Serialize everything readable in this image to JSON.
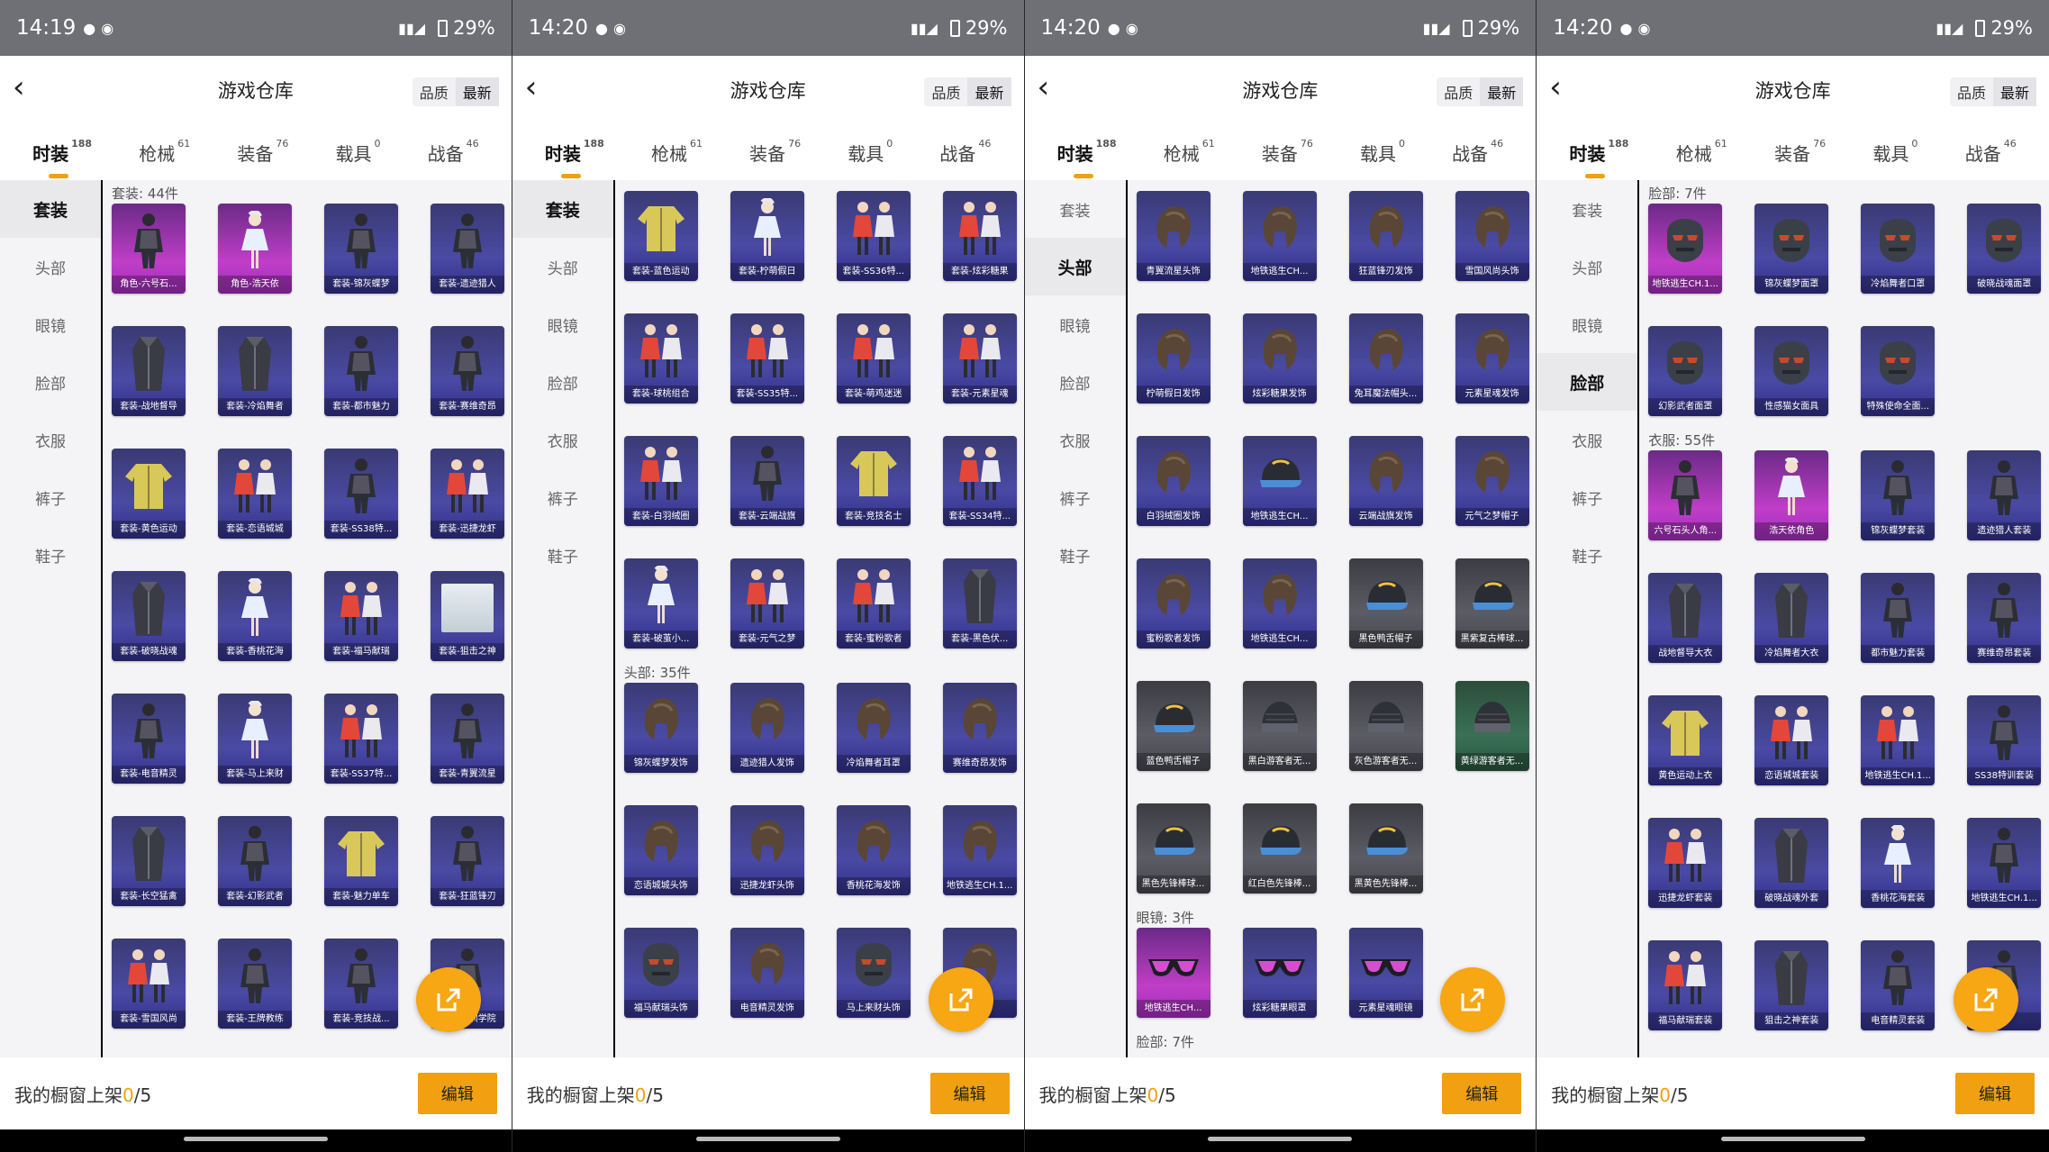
{
  "screens": [
    {
      "status": {
        "time": "14:19",
        "battery": "29%"
      },
      "header": {
        "title": "游戏仓库",
        "sort": [
          "品质",
          "最新"
        ]
      },
      "tabs": [
        {
          "label": "时装",
          "count": "188",
          "active": true
        },
        {
          "label": "枪械",
          "count": "61"
        },
        {
          "label": "装备",
          "count": "76"
        },
        {
          "label": "载具",
          "count": "0"
        },
        {
          "label": "战备",
          "count": "46"
        }
      ],
      "sidebar": [
        {
          "label": "套装",
          "active": true
        },
        {
          "label": "头部"
        },
        {
          "label": "眼镜"
        },
        {
          "label": "脸部"
        },
        {
          "label": "衣服"
        },
        {
          "label": "裤子"
        },
        {
          "label": "鞋子"
        }
      ],
      "sections": [
        {
          "title": "套装: 44件",
          "items": [
            {
              "name": "角色-六号石...",
              "icon": "outfit",
              "r": 0
            },
            {
              "name": "角色-浩天依",
              "icon": "girl",
              "r": 0
            },
            {
              "name": "套装-锦灰蝶梦",
              "icon": "outfit",
              "r": 1
            },
            {
              "name": "套装-遗迹猎人",
              "icon": "outfit",
              "r": 1
            },
            {
              "name": "套装-战地督导",
              "icon": "coat",
              "r": 1
            },
            {
              "name": "套装-冷焰舞者",
              "icon": "coat",
              "r": 1
            },
            {
              "name": "套装-都市魅力",
              "icon": "outfit",
              "r": 1
            },
            {
              "name": "套装-赛维奇昂",
              "icon": "outfit",
              "r": 1
            },
            {
              "name": "套装-黄色运动",
              "icon": "jacket",
              "r": 1
            },
            {
              "name": "套装-恋语城城",
              "icon": "pair",
              "r": 1
            },
            {
              "name": "套装-SS38特...",
              "icon": "outfit",
              "r": 1
            },
            {
              "name": "套装-迅捷龙虾",
              "icon": "pair",
              "r": 1
            },
            {
              "name": "套装-破晓战魂",
              "icon": "coat",
              "r": 1
            },
            {
              "name": "套装-香桃花海",
              "icon": "girl",
              "r": 1
            },
            {
              "name": "套装-福马献瑞",
              "icon": "pair",
              "r": 1
            },
            {
              "name": "套装-狙击之神",
              "icon": "photo",
              "r": 1
            },
            {
              "name": "套装-电音精灵",
              "icon": "outfit",
              "r": 1
            },
            {
              "name": "套装-马上来财",
              "icon": "girl",
              "r": 1
            },
            {
              "name": "套装-SS37特...",
              "icon": "pair",
              "r": 1
            },
            {
              "name": "套装-青翼流星",
              "icon": "outfit",
              "r": 1
            },
            {
              "name": "套装-长空猛禽",
              "icon": "coat",
              "r": 1
            },
            {
              "name": "套装-幻影武者",
              "icon": "outfit",
              "r": 1
            },
            {
              "name": "套装-魅力单车",
              "icon": "jacket",
              "r": 1
            },
            {
              "name": "套装-狂蓝锋刃",
              "icon": "outfit",
              "r": 1
            },
            {
              "name": "套装-雪国风尚",
              "icon": "pair",
              "r": 1
            },
            {
              "name": "套装-王牌教练",
              "icon": "outfit",
              "r": 1
            },
            {
              "name": "套装-竞技战...",
              "icon": "outfit",
              "r": 1
            },
            {
              "name": "套装-特训学院",
              "icon": "outfit",
              "r": 1
            }
          ]
        }
      ],
      "bottom": {
        "label": "我的橱窗上架",
        "count": "0",
        "total": "/5",
        "edit": "编辑"
      }
    },
    {
      "status": {
        "time": "14:20",
        "battery": "29%"
      },
      "header": {
        "title": "游戏仓库",
        "sort": [
          "品质",
          "最新"
        ]
      },
      "tabs": [
        {
          "label": "时装",
          "count": "188",
          "active": true
        },
        {
          "label": "枪械",
          "count": "61"
        },
        {
          "label": "装备",
          "count": "76"
        },
        {
          "label": "载具",
          "count": "0"
        },
        {
          "label": "战备",
          "count": "46"
        }
      ],
      "sidebar": [
        {
          "label": "套装",
          "active": true
        },
        {
          "label": "头部"
        },
        {
          "label": "眼镜"
        },
        {
          "label": "脸部"
        },
        {
          "label": "衣服"
        },
        {
          "label": "裤子"
        },
        {
          "label": "鞋子"
        }
      ],
      "sections": [
        {
          "title": "",
          "items": [
            {
              "name": "套装-蓝色运动",
              "icon": "jacket",
              "r": 1
            },
            {
              "name": "套装-柠萌假日",
              "icon": "girl",
              "r": 1
            },
            {
              "name": "套装-SS36特...",
              "icon": "pair",
              "r": 1
            },
            {
              "name": "套装-炫彩糖果",
              "icon": "pair",
              "r": 1
            },
            {
              "name": "套装-球桃组合",
              "icon": "pair",
              "r": 1
            },
            {
              "name": "套装-SS35特...",
              "icon": "pair",
              "r": 1
            },
            {
              "name": "套装-萌鸡迷迷",
              "icon": "pair",
              "r": 1
            },
            {
              "name": "套装-元素星魂",
              "icon": "pair",
              "r": 1
            },
            {
              "name": "套装-白羽绒圈",
              "icon": "pair",
              "r": 1
            },
            {
              "name": "套装-云端战旗",
              "icon": "outfit",
              "r": 1
            },
            {
              "name": "套装-竞技名士",
              "icon": "jacket",
              "r": 1
            },
            {
              "name": "套装-SS34特...",
              "icon": "pair",
              "r": 1
            },
            {
              "name": "套装-破茧小...",
              "icon": "girl",
              "r": 1
            },
            {
              "name": "套装-元气之梦",
              "icon": "pair",
              "r": 1
            },
            {
              "name": "套装-蜜粉歌者",
              "icon": "pair",
              "r": 1
            },
            {
              "name": "套装-黑色伏...",
              "icon": "coat",
              "r": 1
            }
          ]
        },
        {
          "title": "头部: 35件",
          "items": [
            {
              "name": "锦灰蝶梦发饰",
              "icon": "hair",
              "r": 1
            },
            {
              "name": "遗迹猎人发饰",
              "icon": "hair",
              "r": 1
            },
            {
              "name": "冷焰舞者耳罩",
              "icon": "hair",
              "r": 1
            },
            {
              "name": "赛维奇昂发饰",
              "icon": "hair",
              "r": 1
            },
            {
              "name": "恋语城城头饰",
              "icon": "hair",
              "r": 1
            },
            {
              "name": "迅捷龙虾头饰",
              "icon": "hair",
              "r": 1
            },
            {
              "name": "香桃花海发饰",
              "icon": "hair",
              "r": 1
            },
            {
              "name": "地铁逃生CH.1...",
              "icon": "hair",
              "r": 1
            },
            {
              "name": "福马献瑞头饰",
              "icon": "mask",
              "r": 1
            },
            {
              "name": "电音精灵发饰",
              "icon": "hair",
              "r": 1
            },
            {
              "name": "马上来财头饰",
              "icon": "mask",
              "r": 1
            },
            {
              "name": "...",
              "icon": "hair",
              "r": 1
            }
          ]
        }
      ],
      "bottom": {
        "label": "我的橱窗上架",
        "count": "0",
        "total": "/5",
        "edit": "编辑"
      }
    },
    {
      "status": {
        "time": "14:20",
        "battery": "29%"
      },
      "header": {
        "title": "游戏仓库",
        "sort": [
          "品质",
          "最新"
        ]
      },
      "tabs": [
        {
          "label": "时装",
          "count": "188",
          "active": true
        },
        {
          "label": "枪械",
          "count": "61"
        },
        {
          "label": "装备",
          "count": "76"
        },
        {
          "label": "载具",
          "count": "0"
        },
        {
          "label": "战备",
          "count": "46"
        }
      ],
      "sidebar": [
        {
          "label": "套装"
        },
        {
          "label": "头部",
          "active": true
        },
        {
          "label": "眼镜"
        },
        {
          "label": "脸部"
        },
        {
          "label": "衣服"
        },
        {
          "label": "裤子"
        },
        {
          "label": "鞋子"
        }
      ],
      "sections": [
        {
          "title": "",
          "items": [
            {
              "name": "青翼流星头饰",
              "icon": "hair",
              "r": 1
            },
            {
              "name": "地铁逃生CH...",
              "icon": "hair",
              "r": 1
            },
            {
              "name": "狂蓝锋刃发饰",
              "icon": "hair",
              "r": 1
            },
            {
              "name": "雪国风尚头饰",
              "icon": "hair",
              "r": 1
            },
            {
              "name": "柠萌假日发饰",
              "icon": "hair",
              "r": 1
            },
            {
              "name": "炫彩糖果发饰",
              "icon": "hair",
              "r": 1
            },
            {
              "name": "兔耳魔法帽头...",
              "icon": "hair",
              "r": 1
            },
            {
              "name": "元素星魂发饰",
              "icon": "hair",
              "r": 1
            },
            {
              "name": "白羽绒圈发饰",
              "icon": "hair",
              "r": 1
            },
            {
              "name": "地铁逃生CH...",
              "icon": "cap",
              "r": 1
            },
            {
              "name": "云端战旗发饰",
              "icon": "hair",
              "r": 1
            },
            {
              "name": "元气之梦帽子",
              "icon": "hair",
              "r": 1
            },
            {
              "name": "蜜粉歌者发饰",
              "icon": "hair",
              "r": 1
            },
            {
              "name": "地铁逃生CH...",
              "icon": "hair",
              "r": 1
            },
            {
              "name": "黑色鸭舌帽子",
              "icon": "cap",
              "r": 2
            },
            {
              "name": "黑紫复古棒球...",
              "icon": "cap",
              "r": 2
            },
            {
              "name": "蓝色鸭舌帽子",
              "icon": "cap",
              "r": 2
            },
            {
              "name": "黑白游客者无...",
              "icon": "beanie",
              "r": 2
            },
            {
              "name": "灰色游客者无...",
              "icon": "beanie",
              "r": 2
            },
            {
              "name": "黄绿游客者无...",
              "icon": "beanie",
              "r": 3
            },
            {
              "name": "黑色先锋棒球...",
              "icon": "cap",
              "r": 2
            },
            {
              "name": "红白色先锋棒...",
              "icon": "cap",
              "r": 2
            },
            {
              "name": "黑黄色先锋棒...",
              "icon": "cap",
              "r": 2
            }
          ]
        },
        {
          "title": "眼镜: 3件",
          "items": [
            {
              "name": "地铁逃生CH...",
              "icon": "glasses",
              "r": 0
            },
            {
              "name": "炫彩糖果眼罩",
              "icon": "glasses",
              "r": 1
            },
            {
              "name": "元素星魂眼镜",
              "icon": "glasses",
              "r": 1
            }
          ]
        },
        {
          "title": "脸部: 7件",
          "items": []
        }
      ],
      "bottom": {
        "label": "我的橱窗上架",
        "count": "0",
        "total": "/5",
        "edit": "编辑"
      }
    },
    {
      "status": {
        "time": "14:20",
        "battery": "29%"
      },
      "header": {
        "title": "游戏仓库",
        "sort": [
          "品质",
          "最新"
        ]
      },
      "tabs": [
        {
          "label": "时装",
          "count": "188",
          "active": true
        },
        {
          "label": "枪械",
          "count": "61"
        },
        {
          "label": "装备",
          "count": "76"
        },
        {
          "label": "载具",
          "count": "0"
        },
        {
          "label": "战备",
          "count": "46"
        }
      ],
      "sidebar": [
        {
          "label": "套装"
        },
        {
          "label": "头部"
        },
        {
          "label": "眼镜"
        },
        {
          "label": "脸部",
          "active": true
        },
        {
          "label": "衣服"
        },
        {
          "label": "裤子"
        },
        {
          "label": "鞋子"
        }
      ],
      "sections": [
        {
          "title": "脸部: 7件",
          "items": [
            {
              "name": "地铁逃生CH.1...",
              "icon": "mask",
              "r": 0
            },
            {
              "name": "锦灰蝶梦面罩",
              "icon": "mask",
              "r": 1
            },
            {
              "name": "冷焰舞者口罩",
              "icon": "mask",
              "r": 1
            },
            {
              "name": "破晓战魂面罩",
              "icon": "mask",
              "r": 1
            },
            {
              "name": "幻影武者面罩",
              "icon": "mask",
              "r": 1
            },
            {
              "name": "性感猫女面具",
              "icon": "mask",
              "r": 1
            },
            {
              "name": "特殊使命全面...",
              "icon": "mask",
              "r": 1
            }
          ]
        },
        {
          "title": "衣服: 55件",
          "items": [
            {
              "name": "六号石头人角...",
              "icon": "outfit",
              "r": 0
            },
            {
              "name": "浩天依角色",
              "icon": "girl",
              "r": 0
            },
            {
              "name": "锦灰蝶梦套装",
              "icon": "outfit",
              "r": 1
            },
            {
              "name": "遗迹猎人套装",
              "icon": "outfit",
              "r": 1
            },
            {
              "name": "战地督导大衣",
              "icon": "coat",
              "r": 1
            },
            {
              "name": "冷焰舞者大衣",
              "icon": "coat",
              "r": 1
            },
            {
              "name": "都市魅力套装",
              "icon": "outfit",
              "r": 1
            },
            {
              "name": "赛维奇昂套装",
              "icon": "outfit",
              "r": 1
            },
            {
              "name": "黄色运动上衣",
              "icon": "jacket",
              "r": 1
            },
            {
              "name": "恋语城城套装",
              "icon": "pair",
              "r": 1
            },
            {
              "name": "地铁逃生CH.1...",
              "icon": "pair",
              "r": 1
            },
            {
              "name": "SS38特训套装",
              "icon": "outfit",
              "r": 1
            },
            {
              "name": "迅捷龙虾套装",
              "icon": "pair",
              "r": 1
            },
            {
              "name": "破晓战魂外套",
              "icon": "coat",
              "r": 1
            },
            {
              "name": "香桃花海套装",
              "icon": "girl",
              "r": 1
            },
            {
              "name": "地铁逃生CH.1...",
              "icon": "outfit",
              "r": 1
            },
            {
              "name": "福马献瑞套装",
              "icon": "pair",
              "r": 1
            },
            {
              "name": "狙击之神套装",
              "icon": "coat",
              "r": 1
            },
            {
              "name": "电音精灵套装",
              "icon": "outfit",
              "r": 1
            },
            {
              "name": "...",
              "icon": "outfit",
              "r": 1
            }
          ]
        }
      ],
      "bottom": {
        "label": "我的橱窗上架",
        "count": "0",
        "total": "/5",
        "edit": "编辑"
      }
    }
  ],
  "colors": {
    "accent": "#f0a010",
    "fab": "#f7a614",
    "status_bar": "#6e7075",
    "card_legendary": "#c03ec8",
    "card_epic": "#4a4aa4"
  }
}
